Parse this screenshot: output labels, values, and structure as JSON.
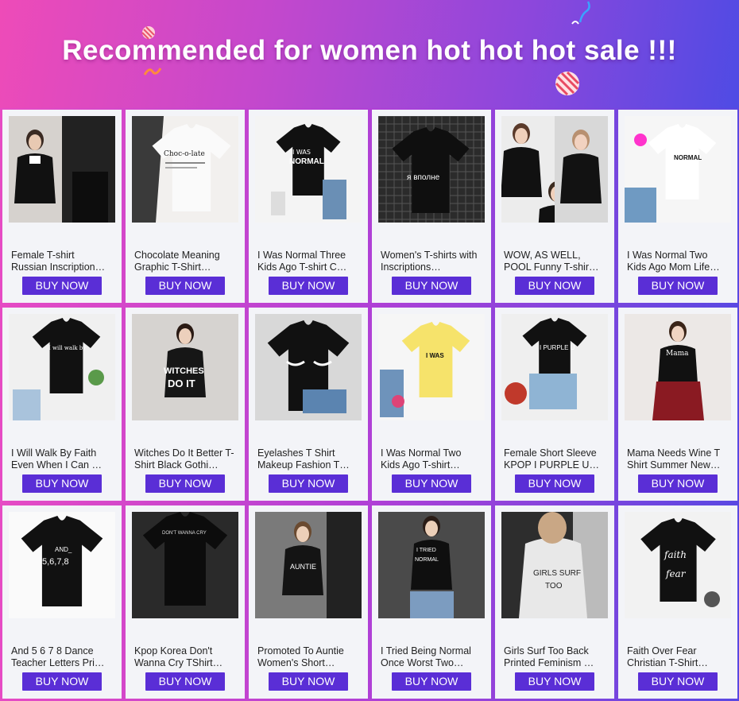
{
  "header": {
    "title": "Recommended for women hot hot hot sale !!!"
  },
  "buy_label": "BUY NOW",
  "products": [
    {
      "name": "Female T-shirt Russian Inscription…",
      "image": "two-models-black-tees",
      "bg": "#e8e6e4"
    },
    {
      "name": "Chocolate Meaning Graphic T-Shirt…",
      "image": "white-tee-chocolate-text",
      "bg": "#f2f0ee"
    },
    {
      "name": "I Was Normal Three Kids Ago T-shirt C…",
      "image": "black-tee-flatlay-jeans",
      "bg": "#f4f4f4"
    },
    {
      "name": "Women's T-shirts with Inscriptions…",
      "image": "black-tee-russian-text",
      "bg": "#222"
    },
    {
      "name": "WOW, AS WELL, POOL Funny T-shir…",
      "image": "three-models-black-tees",
      "bg": "#ececec"
    },
    {
      "name": "I Was Normal Two Kids Ago Mom Life…",
      "image": "white-tee-flatlay",
      "bg": "#f6f6f6"
    },
    {
      "name": "I Will Walk By Faith Even When I Can …",
      "image": "black-tee-faith-script",
      "bg": "#f0f0f0"
    },
    {
      "name": "Witches Do It Better T-Shirt Black Gothi…",
      "image": "model-witches-tee",
      "bg": "#e4e2e0"
    },
    {
      "name": "Eyelashes T Shirt Makeup Fashion T…",
      "image": "black-tee-eyelashes",
      "bg": "#d8d8d8"
    },
    {
      "name": "I Was Normal Two Kids Ago T-shirt…",
      "image": "yellow-tee-flatlay",
      "bg": "#f6f6f6"
    },
    {
      "name": "Female Short Sleeve KPOP I PURPLE U…",
      "image": "black-tee-i-purple-u",
      "bg": "#efefef"
    },
    {
      "name": "Mama Needs Wine T Shirt Summer New…",
      "image": "model-mama-wine",
      "bg": "#ebe9e9"
    },
    {
      "name": "And 5 6 7 8 Dance Teacher Letters Pri…",
      "image": "black-tee-5678",
      "bg": "#fafafa"
    },
    {
      "name": "Kpop Korea Don't Wanna Cry TShirt…",
      "image": "black-tee-dont-wanna-cry",
      "bg": "#2a2a2a"
    },
    {
      "name": "Promoted To Auntie Women's Short…",
      "image": "model-auntie",
      "bg": "#6b6b6b"
    },
    {
      "name": "I Tried Being Normal Once Worst Two…",
      "image": "model-tried-normal",
      "bg": "#555"
    },
    {
      "name": "Girls Surf Too Back Printed Feminism …",
      "image": "model-girls-surf-back",
      "bg": "#3a3a3a"
    },
    {
      "name": "Faith Over Fear Christian T-Shirt…",
      "image": "black-tee-faith-over-fear",
      "bg": "#f2f2f2"
    }
  ]
}
